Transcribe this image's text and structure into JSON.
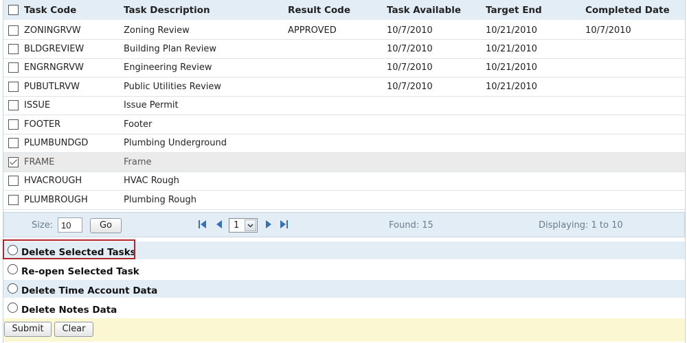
{
  "table": {
    "headers": {
      "task_code": "Task Code",
      "task_description": "Task Description",
      "result_code": "Result Code",
      "task_available": "Task Available",
      "target_end": "Target End",
      "completed_date": "Completed Date"
    },
    "rows": [
      {
        "code": "ZONINGRVW",
        "description": "Zoning Review",
        "result": "APPROVED",
        "available": "10/7/2010",
        "target_end": "10/21/2010",
        "completed": "10/7/2010"
      },
      {
        "code": "BLDGREVIEW",
        "description": "Building Plan Review",
        "result": "",
        "available": "10/7/2010",
        "target_end": "10/21/2010",
        "completed": ""
      },
      {
        "code": "ENGRNGRVW",
        "description": "Engineering Review",
        "result": "",
        "available": "10/7/2010",
        "target_end": "10/21/2010",
        "completed": ""
      },
      {
        "code": "PUBUTLRVW",
        "description": "Public Utilities Review",
        "result": "",
        "available": "10/7/2010",
        "target_end": "10/21/2010",
        "completed": ""
      },
      {
        "code": "ISSUE",
        "description": "Issue Permit",
        "result": "",
        "available": "",
        "target_end": "",
        "completed": ""
      },
      {
        "code": "FOOTER",
        "description": "Footer",
        "result": "",
        "available": "",
        "target_end": "",
        "completed": ""
      },
      {
        "code": "PLUMBUNDGD",
        "description": "Plumbing Underground",
        "result": "",
        "available": "",
        "target_end": "",
        "completed": ""
      },
      {
        "code": "FRAME",
        "description": "Frame",
        "result": "",
        "available": "",
        "target_end": "",
        "completed": ""
      },
      {
        "code": "HVACROUGH",
        "description": "HVAC Rough",
        "result": "",
        "available": "",
        "target_end": "",
        "completed": ""
      },
      {
        "code": "PLUMBROUGH",
        "description": "Plumbing Rough",
        "result": "",
        "available": "",
        "target_end": "",
        "completed": ""
      }
    ]
  },
  "pager": {
    "size_label": "Size:",
    "size_value": "10",
    "go_label": "Go",
    "page_value": "1",
    "found": "Found: 15",
    "displaying": "Displaying: 1 to 10"
  },
  "options": {
    "delete_selected": "Delete Selected Tasks",
    "reopen_selected": "Re-open Selected Task",
    "delete_time_account": "Delete Time Account Data",
    "delete_notes": "Delete Notes Data"
  },
  "footer": {
    "submit_label": "Submit",
    "clear_label": "Clear"
  },
  "colors": {
    "header_bg": "#e3edf6",
    "selected_row_bg": "#ebebeb",
    "highlight_border": "#b0262b",
    "footer_bg": "#fbf7d2"
  }
}
